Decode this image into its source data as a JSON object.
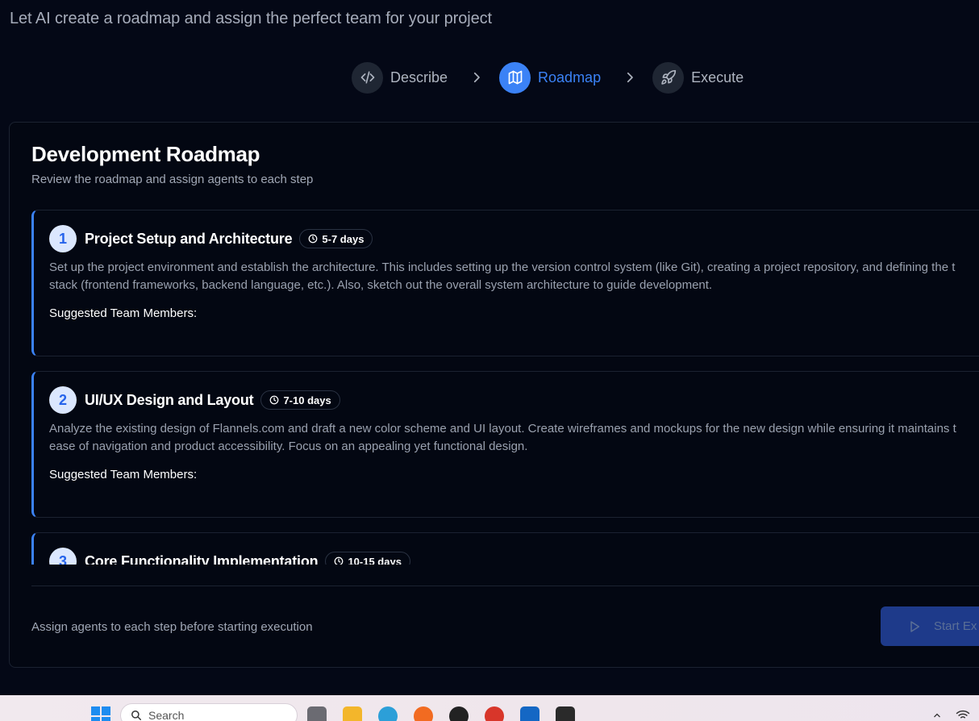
{
  "header": {
    "subtitle": "Let AI create a roadmap and assign the perfect team for your project"
  },
  "stepper": {
    "steps": [
      {
        "label": "Describe",
        "icon": "code-icon",
        "active": false
      },
      {
        "label": "Roadmap",
        "icon": "map-icon",
        "active": true
      },
      {
        "label": "Execute",
        "icon": "rocket-icon",
        "active": false
      }
    ]
  },
  "roadmap": {
    "title": "Development Roadmap",
    "description": "Review the roadmap and assign agents to each step",
    "steps": [
      {
        "number": "1",
        "title": "Project Setup and Architecture",
        "duration": "5-7 days",
        "text_line1": "Set up the project environment and establish the architecture. This includes setting up the version control system (like Git), creating a project repository, and defining the t",
        "text_line2": "stack (frontend frameworks, backend language, etc.). Also, sketch out the overall system architecture to guide development.",
        "members_label": "Suggested Team Members:"
      },
      {
        "number": "2",
        "title": "UI/UX Design and Layout",
        "duration": "7-10 days",
        "text_line1": "Analyze the existing design of Flannels.com and draft a new color scheme and UI layout. Create wireframes and mockups for the new design while ensuring it maintains t",
        "text_line2": "ease of navigation and product accessibility. Focus on an appealing yet functional design.",
        "members_label": "Suggested Team Members:"
      },
      {
        "number": "3",
        "title": "Core Functionality Implementation",
        "duration": "10-15 days",
        "text_line1": "",
        "text_line2": "",
        "members_label": ""
      }
    ],
    "footer_note": "Assign agents to each step before starting execution",
    "start_button": "Start Ex"
  },
  "taskbar": {
    "search_placeholder": "Search"
  },
  "colors": {
    "background": "#040816",
    "accent": "#3b82f6",
    "button": "#1e3a8a"
  }
}
